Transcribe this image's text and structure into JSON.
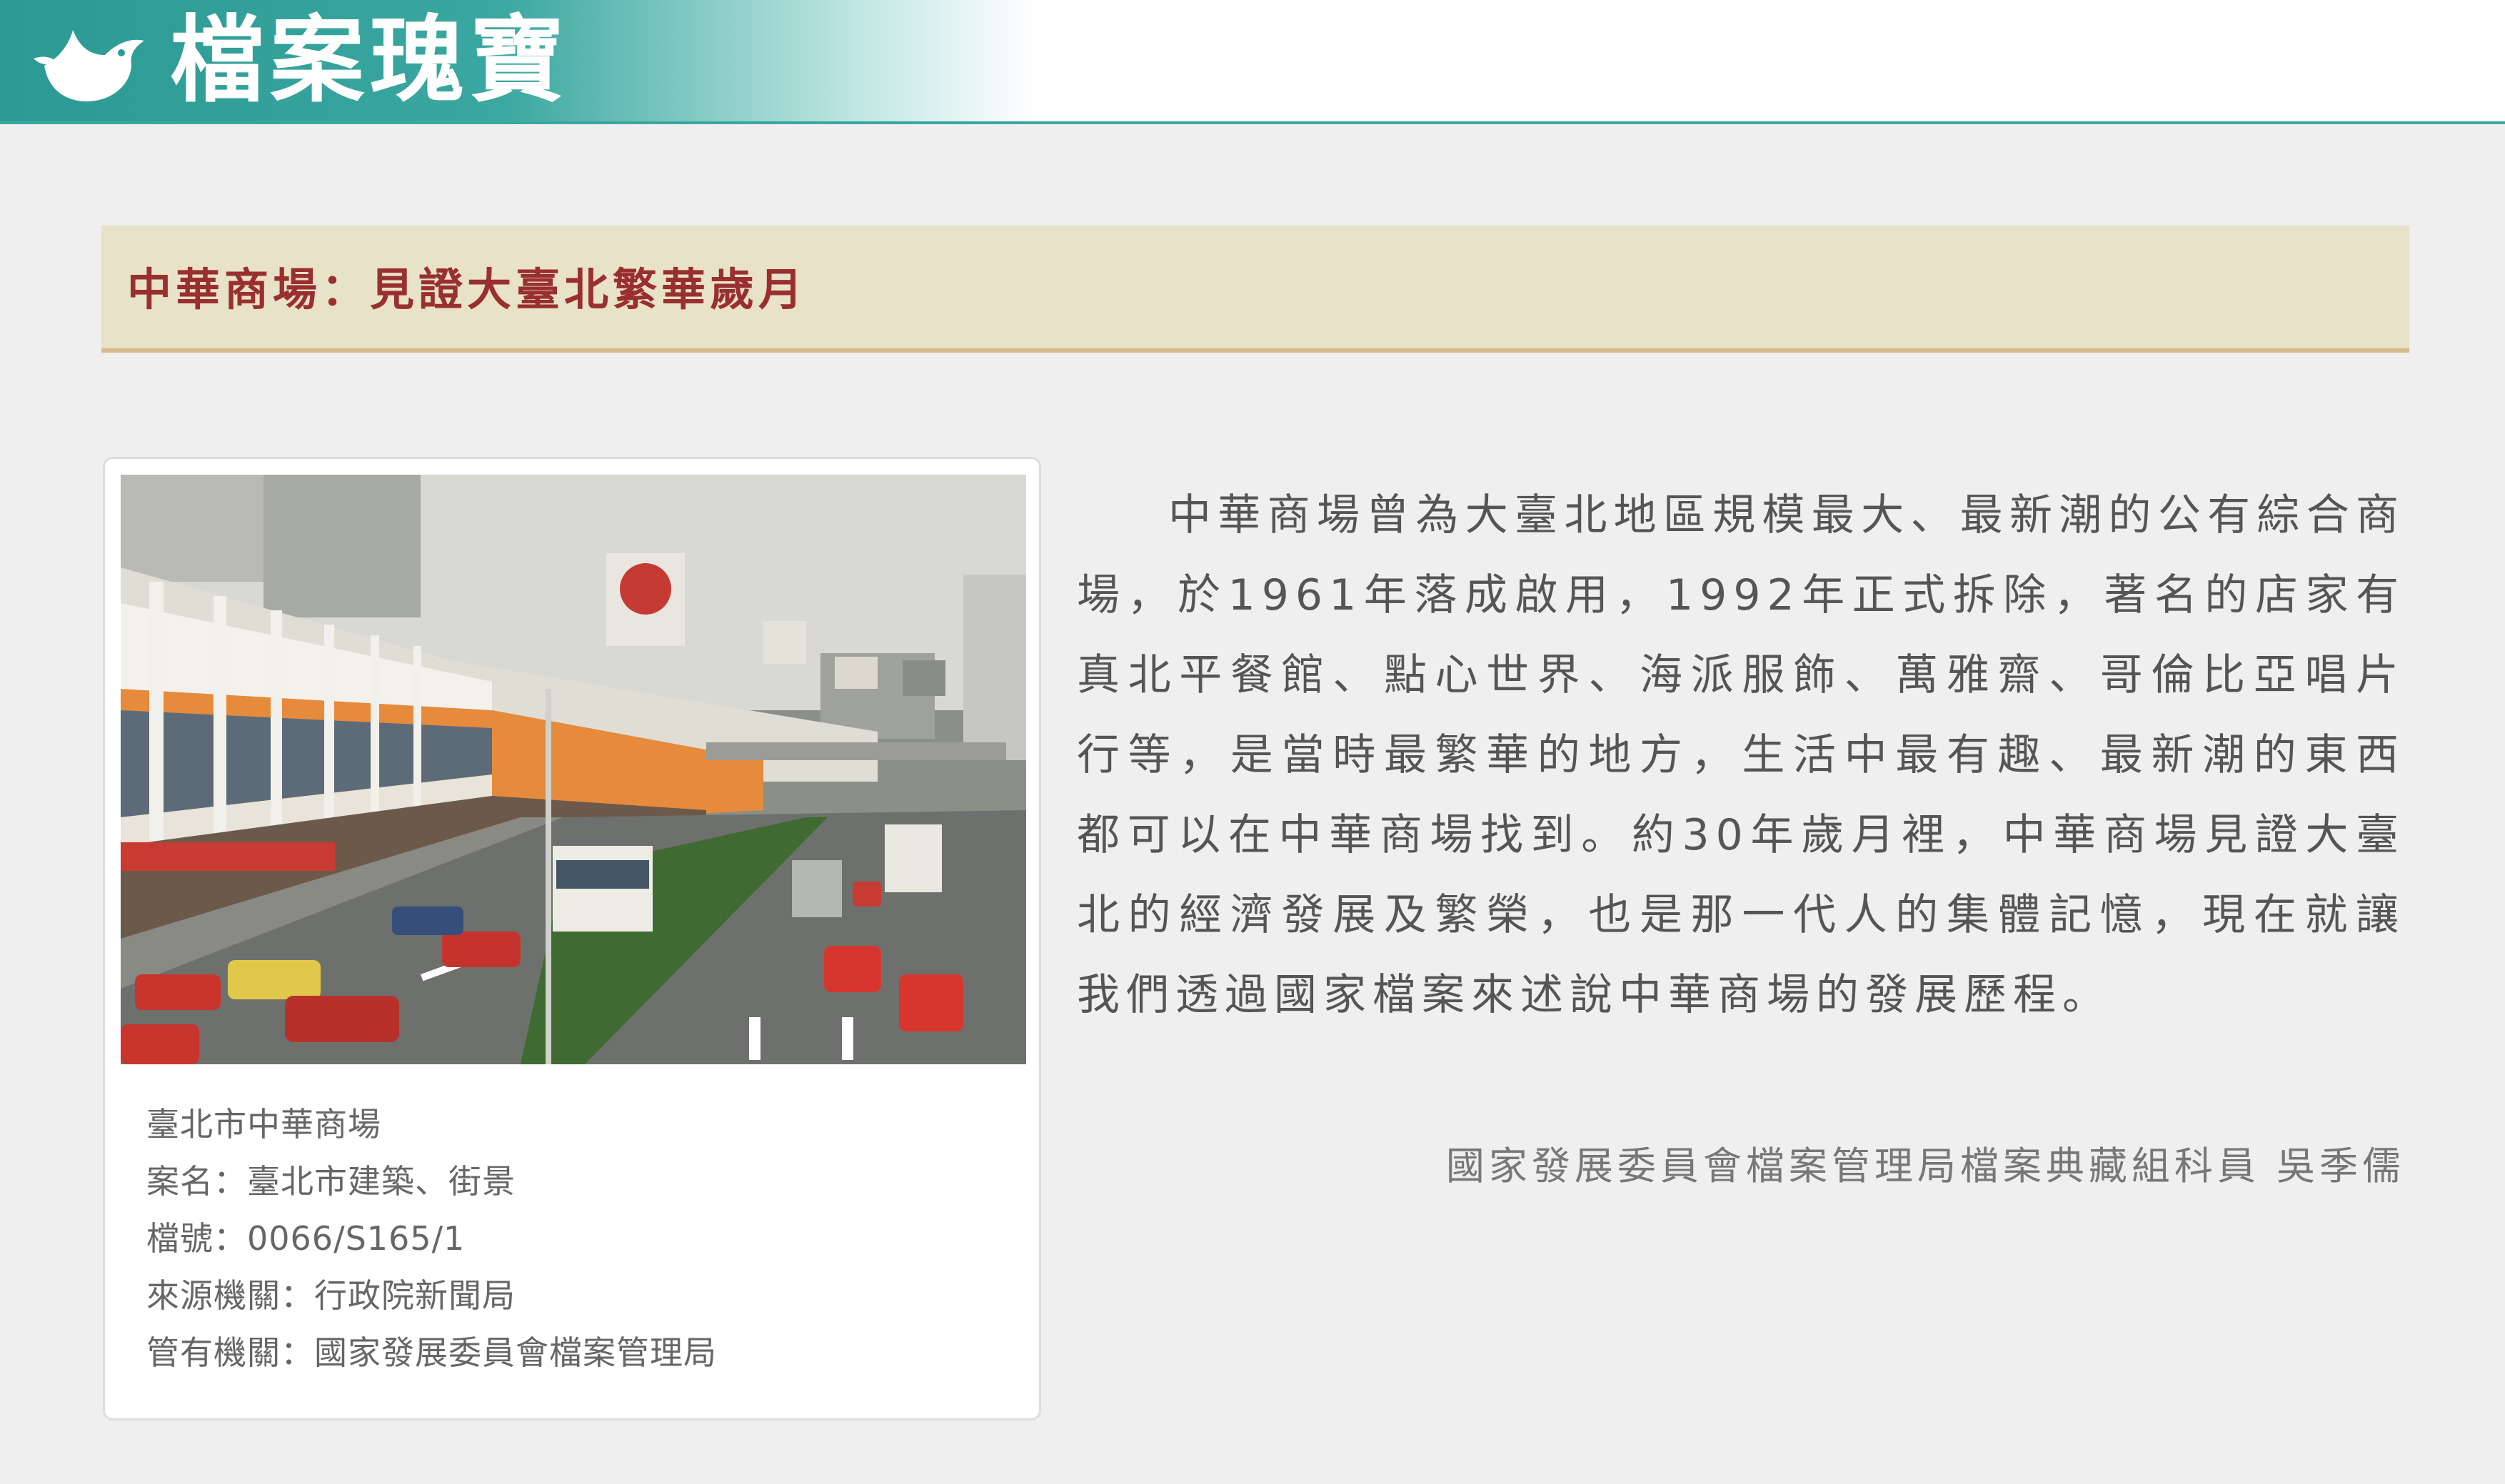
{
  "header": {
    "site_title": "檔案瑰寶",
    "logo_icon": "white-bird-icon",
    "color_start": "#2b9a93"
  },
  "banner": {
    "title": "中華商場：見證大臺北繁華歲月",
    "title_color": "#9a2f2f",
    "background": "#e7e2c8"
  },
  "photo_card": {
    "image_description": "street-scene-photo",
    "caption_lines": [
      "臺北市中華商場",
      "案名：臺北市建築、街景",
      "檔號：0066/S165/1",
      "來源機關：行政院新聞局",
      "管有機關：國家發展委員會檔案管理局"
    ]
  },
  "article": {
    "body": "中華商場曾為大臺北地區規模最大、最新潮的公有綜合商場，於1961年落成啟用，1992年正式拆除，著名的店家有真北平餐館、點心世界、海派服飾、萬雅齋、哥倫比亞唱片行等，是當時最繁華的地方，生活中最有趣、最新潮的東西都可以在中華商場找到。約30年歲月裡，中華商場見證大臺北的經濟發展及繁榮，也是那一代人的集體記憶，現在就讓我們透過國家檔案來述說中華商場的發展歷程。",
    "author": "國家發展委員會檔案管理局檔案典藏組科員 吳季儒"
  }
}
